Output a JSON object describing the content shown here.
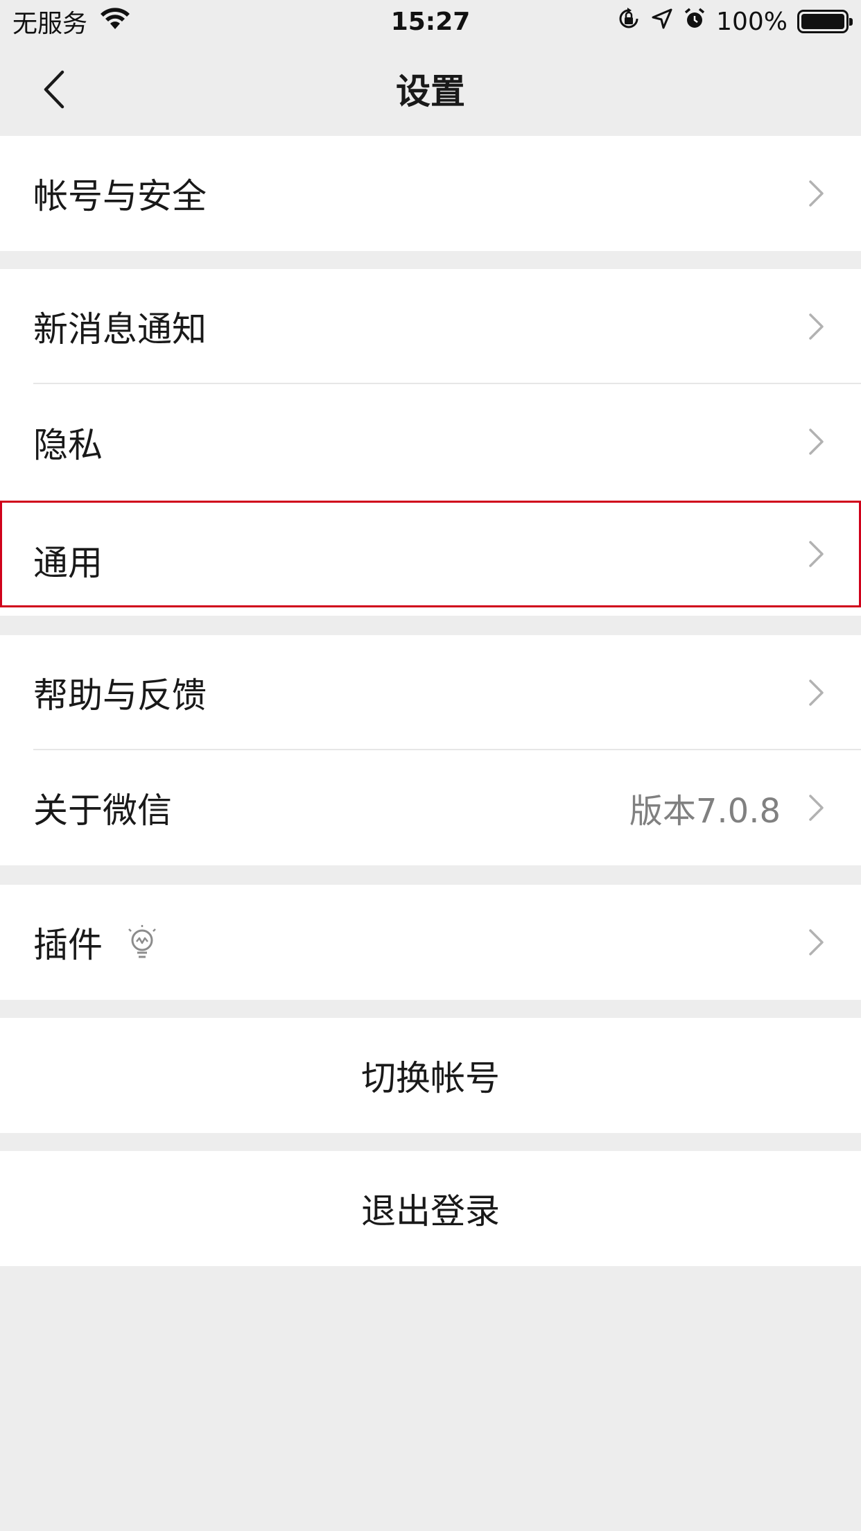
{
  "status_bar": {
    "carrier": "无服务",
    "time": "15:27",
    "battery_percent": "100%",
    "icons": [
      "wifi-icon",
      "rotation-lock-icon",
      "location-arrow-icon",
      "alarm-icon",
      "battery-icon"
    ]
  },
  "nav": {
    "title": "设置",
    "back_icon": "back-chevron-icon"
  },
  "sections": {
    "account": {
      "label": "帐号与安全"
    },
    "notifications": {
      "label": "新消息通知"
    },
    "privacy": {
      "label": "隐私"
    },
    "general": {
      "label": "通用"
    },
    "help": {
      "label": "帮助与反馈"
    },
    "about": {
      "label": "关于微信",
      "value": "版本7.0.8"
    },
    "plugins": {
      "label": "插件",
      "icon": "lightbulb-icon"
    },
    "switch_account": {
      "label": "切换帐号"
    },
    "logout": {
      "label": "退出登录"
    }
  },
  "colors": {
    "background": "#ededed",
    "cell": "#ffffff",
    "text": "#191919",
    "secondary_text": "#808080",
    "chevron": "#b2b2b2",
    "highlight": "#d0021b"
  }
}
